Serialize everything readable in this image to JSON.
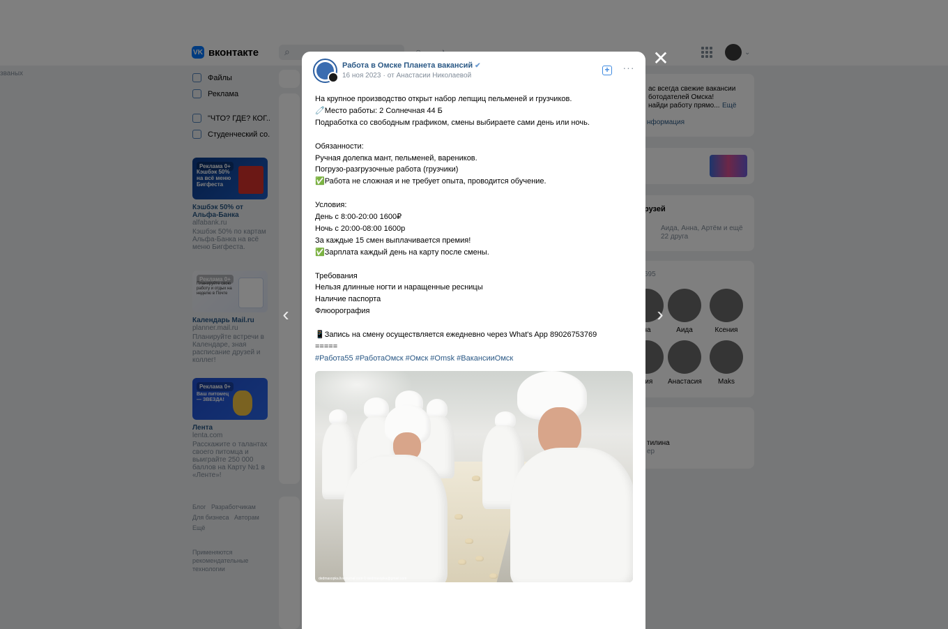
{
  "background": {
    "logo_text": "вконтакте",
    "logo_mark": "VK",
    "edge_text": "званых",
    "left_nav": [
      {
        "label": "Файлы"
      },
      {
        "label": "Реклама"
      },
      {
        "label": "\"ЧТО? ГДЕ? КОГ..."
      },
      {
        "label": "Студенческий со..."
      }
    ],
    "ads": [
      {
        "badge": "Реклама 0+",
        "image_caption": "Кэшбэк 50% на всё меню Бигфеста",
        "title": "Кэшбэк 50% от Альфа-Банка",
        "domain": "alfabank.ru",
        "desc": "Кэшбэк 50% по картам Альфа-Банка на всё меню Бигфеста."
      },
      {
        "badge": "Реклама 0+",
        "image_caption": "Планируйте свою работу и отдых на неделю в Почте",
        "title": "Календарь Mail.ru",
        "domain": "planner.mail.ru",
        "desc": "Планируйте встречи в Календаре, зная расписание друзей и коллег!"
      },
      {
        "badge": "Реклама 0+",
        "image_caption": "Ваш питомец — ЗВЕЗДА!",
        "title": "Лента",
        "domain": "lenta.com",
        "desc": "Расскажите о талантах своего питомца и выиграйте 250 000 баллов на Карту №1 в «Ленте»!"
      }
    ],
    "footer_links": [
      "Блог",
      "Разработчикам",
      "Для бизнеса",
      "Авторам",
      "Ещё"
    ],
    "footer_note": "Применяются рекомендательные технологии",
    "right_column": {
      "about_line1": "ас всегда свежие вакансии",
      "about_line2": "ботодателей Омска!",
      "about_line3": "найди работу прямо...",
      "about_more": "Ещё",
      "about_info": "нформация",
      "friends_title": "рузей",
      "friends_names": "Аида, Анна, Артём и ещё",
      "friends_count": "22 друга",
      "followers_count": "695",
      "friends": [
        "на",
        "Аида",
        "Ксения",
        "рия",
        "Анастасия",
        "Maks"
      ],
      "contact_name": "тилина",
      "contact_sub": "ер"
    }
  },
  "modal": {
    "group_name": "Работа в Омске Планета вакансий",
    "verified_icon": "checkmark-icon",
    "date": "16 ноя 2023",
    "author": "от Анастасии Николаевой",
    "post_lines": [
      "На крупное производство открыт набор лепщиц пельменей и грузчиков.",
      "🧷Место работы: 2 Солнечная 44 Б",
      "Подработка со свободным графиком, смены выбираете сами день или ночь.",
      "",
      "Обязанности:",
      "Ручная долепка мант, пельменей, вареников.",
      "Погрузо-разгрузочные работа (грузчики)",
      "✅Работа не сложная и не требует опыта, проводится обучение.",
      "",
      "Условия:",
      "День с 8:00-20:00 1600₽",
      "Ночь с 20:00-08:00 1600р",
      "За каждые 15 смен выплачивается премия!",
      "✅Зарплата каждый день на карту после смены.",
      "",
      "Требования",
      "Нельзя длинные ногти и наращенные ресницы",
      "Наличие паспорта",
      "Флюорография",
      "",
      "📱Запись на смену осуществляется ежедневно через What's App 89026753769",
      "====="
    ],
    "hashtags": [
      "#Работа55",
      "#РаботаОмск",
      "#Омск",
      "#Omsk",
      "#ВакансииОмск"
    ],
    "photo_caption": "dedmaxopka.livejournal.com © dedmaxopka@gmail.com",
    "nav": {
      "prev": "‹",
      "next": "›",
      "close": "✕"
    }
  }
}
